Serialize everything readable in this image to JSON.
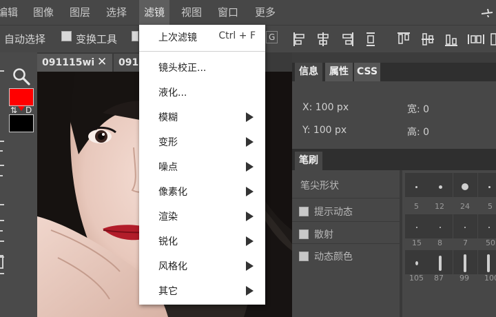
{
  "menubar": {
    "items": [
      "编辑",
      "图像",
      "图层",
      "选择",
      "滤镜",
      "视图",
      "窗口",
      "更多"
    ],
    "active": "滤镜",
    "right_icon": "plane-icon"
  },
  "options": {
    "auto_select": "自动选择",
    "transform_tool": "变换工具",
    "partial_text": "G",
    "toggle_label": "> <"
  },
  "tabs": [
    {
      "label": "091115wi",
      "close": "✕"
    },
    {
      "label": "091"
    }
  ],
  "colors": {
    "foreground": "#ff0000",
    "background": "#000000",
    "swap_label": "⇅",
    "default_label": "D"
  },
  "info_panel": {
    "tabs": [
      "信息",
      "属性",
      "CSS"
    ],
    "x": "X: 100 px",
    "y": "Y: 100 px",
    "width": "宽: 0",
    "height": "高: 0"
  },
  "brush_panel": {
    "tab": "笔刷",
    "tip_shape": "笔尖形状",
    "options": [
      "提示动态",
      "散射",
      "动态颜色"
    ],
    "sizes": [
      "5",
      "12",
      "24",
      "5",
      "15",
      "8",
      "7",
      "50",
      "105",
      "87",
      "99",
      "100"
    ]
  },
  "filter_menu": {
    "items": [
      {
        "label": "上次滤镜",
        "shortcut": "Ctrl + F",
        "submenu": false
      },
      {
        "label": "镜头校正...",
        "submenu": false
      },
      {
        "label": "液化...",
        "submenu": false
      },
      {
        "label": "模糊",
        "submenu": true
      },
      {
        "label": "变形",
        "submenu": true
      },
      {
        "label": "噪点",
        "submenu": true
      },
      {
        "label": "像素化",
        "submenu": true
      },
      {
        "label": "渲染",
        "submenu": true
      },
      {
        "label": "锐化",
        "submenu": true
      },
      {
        "label": "风格化",
        "submenu": true
      },
      {
        "label": "其它",
        "submenu": true
      }
    ]
  }
}
